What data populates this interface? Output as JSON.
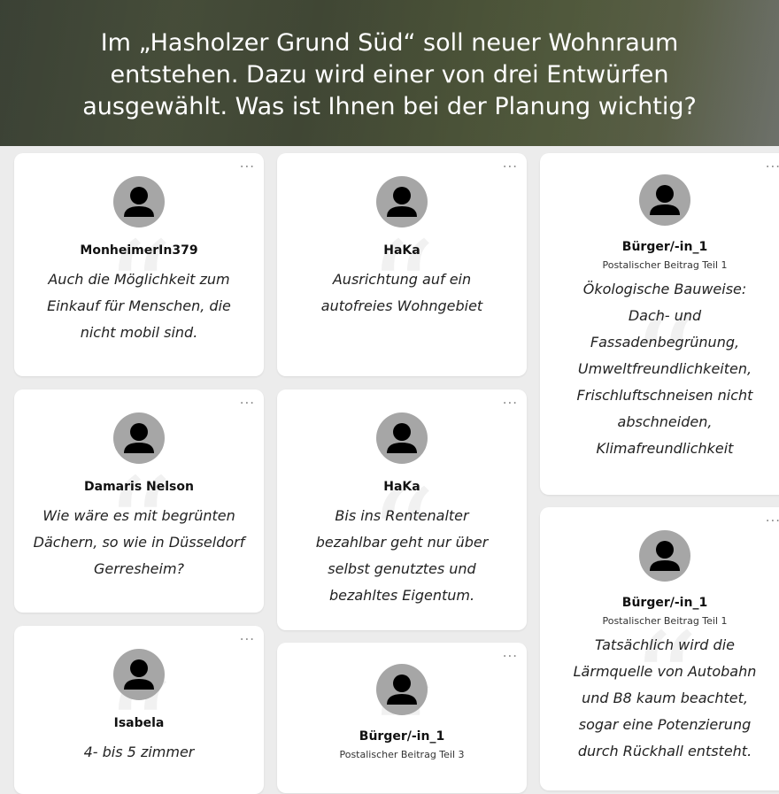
{
  "banner": {
    "title": "Im „Hasholzer Grund Süd“ soll neuer Wohnraum entstehen. Dazu wird einer von drei Entwürfen ausgewählt. Was ist Ihnen bei der Planung wichtig?"
  },
  "ui": {
    "more_label": "..."
  },
  "cards": [
    {
      "author": "MonheimerIn379",
      "subtitle": "",
      "text": "Auch die Möglichkeit zum Einkauf für Menschen, die nicht mobil sind."
    },
    {
      "author": "HaKa",
      "subtitle": "",
      "text": "Ausrichtung auf ein autofreies Wohngebiet"
    },
    {
      "author": "Bürger/-in_1",
      "subtitle": "Postalischer Beitrag Teil 1",
      "text": "Ökologische Bauweise: Dach- und Fassadenbegrünung, Umweltfreundlichkeiten, Frischluftschneisen nicht abschneiden, Klimafreundlichkeit"
    },
    {
      "author": "Damaris Nelson",
      "subtitle": "",
      "text": "Wie wäre es mit begrünten Dächern, so wie in Düsseldorf Gerresheim?"
    },
    {
      "author": "HaKa",
      "subtitle": "",
      "text": "Bis ins Rentenalter bezahlbar geht nur über selbst genutztes und bezahltes Eigentum."
    },
    {
      "author": "Bürger/-in_1",
      "subtitle": "Postalischer Beitrag Teil 1",
      "text": "Tatsächlich wird die Lärmquelle von Autobahn und B8 kaum beachtet, sogar eine Potenzierung durch Rückhall entsteht."
    },
    {
      "author": "Isabela",
      "subtitle": "",
      "text": "4- bis 5 zimmer"
    },
    {
      "author": "Bürger/-in_1",
      "subtitle": "Postalischer Beitrag Teil 3",
      "text": ""
    }
  ]
}
